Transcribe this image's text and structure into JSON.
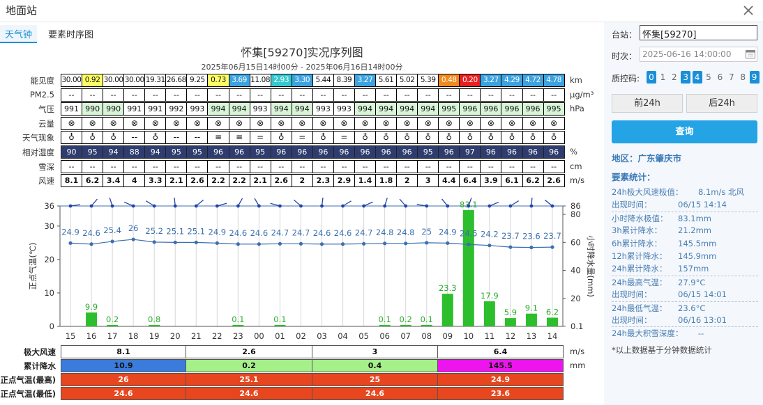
{
  "window": {
    "title": "地面站"
  },
  "tabs": [
    "天气钟",
    "要素时序图"
  ],
  "chart": {
    "title": "怀集[59270]实况序列图",
    "subtitle": "2025年06月15日14时00分 - 2025年06月16日14时00分"
  },
  "rows": [
    {
      "label": "能见度",
      "unit": "km",
      "kind": "vis",
      "values": [
        "30.00",
        "0.92",
        "30.00",
        "30.00",
        "19.31",
        "26.68",
        "9.25",
        "0.73",
        "3.69",
        "11.08",
        "2.93",
        "3.30",
        "5.44",
        "8.39",
        "3.27",
        "5.61",
        "5.02",
        "5.39",
        "0.48",
        "0.20",
        "3.27",
        "4.29",
        "4.72",
        "4.78"
      ]
    },
    {
      "label": "PM2.5",
      "unit": "μg/m³",
      "kind": "plain",
      "values": [
        "--",
        "--",
        "--",
        "--",
        "--",
        "--",
        "--",
        "--",
        "--",
        "--",
        "--",
        "--",
        "--",
        "--",
        "--",
        "--",
        "--",
        "--",
        "--",
        "--",
        "--",
        "--",
        "--",
        "--"
      ]
    },
    {
      "label": "气压",
      "unit": "hPa",
      "kind": "press",
      "values": [
        "991",
        "990",
        "990",
        "991",
        "991",
        "992",
        "993",
        "994",
        "994",
        "993",
        "994",
        "994",
        "993",
        "993",
        "994",
        "994",
        "994",
        "994",
        "995",
        "996",
        "996",
        "996",
        "996",
        "995"
      ]
    },
    {
      "label": "云量",
      "unit": "",
      "kind": "wx",
      "values": [
        "⊗",
        "⊗",
        "⊗",
        "⊗",
        "⊗",
        "⊗",
        "⊗",
        "⊗",
        "⊗",
        "⊗",
        "⊗",
        "⊗",
        "⊗",
        "⊗",
        "⊗",
        "⊗",
        "⊗",
        "⊗",
        "⊗",
        "⊗",
        "⊗",
        "⊗",
        "⊗",
        "⊗"
      ]
    },
    {
      "label": "天气现象",
      "unit": "",
      "kind": "wx",
      "values": [
        "♁",
        "♁",
        "♁",
        "--",
        "♁",
        "--",
        "--",
        "≡",
        "≡",
        "=",
        "♁",
        "=",
        "♁",
        "=",
        "♁",
        "♁",
        "♁",
        "♁",
        "♁",
        "♁",
        "♁",
        "♁",
        "♁",
        "♁"
      ]
    },
    {
      "label": "相对湿度",
      "unit": "%",
      "kind": "hum",
      "values": [
        "90",
        "95",
        "94",
        "88",
        "94",
        "95",
        "95",
        "96",
        "96",
        "95",
        "96",
        "96",
        "96",
        "96",
        "96",
        "96",
        "96",
        "95",
        "96",
        "97",
        "96",
        "96",
        "96",
        "96"
      ]
    },
    {
      "label": "雪深",
      "unit": "cm",
      "kind": "plain",
      "values": [
        "--",
        "--",
        "--",
        "--",
        "--",
        "--",
        "--",
        "--",
        "--",
        "--",
        "--",
        "--",
        "--",
        "--",
        "--",
        "--",
        "--",
        "--",
        "--",
        "--",
        "--",
        "--",
        "--",
        "--"
      ]
    },
    {
      "label": "风速",
      "unit": "m/s",
      "kind": "bold",
      "values": [
        "8.1",
        "6.2",
        "3.4",
        "4",
        "3.3",
        "2.1",
        "2.6",
        "2.2",
        "2.2",
        "2.1",
        "2.6",
        "2",
        "2.3",
        "2.9",
        "1.4",
        "1.8",
        "2",
        "3",
        "4.4",
        "6.4",
        "3.9",
        "6.1",
        "6.2",
        "2.6"
      ]
    }
  ],
  "cell_colors": {
    "vis": [
      "#fff",
      "#ffff66",
      "#fff",
      "#fff",
      "#fff",
      "#fff",
      "#fff",
      "#ffff66",
      "#3da3e0",
      "#fff",
      "#34c9d0",
      "#3da3e0",
      "#fff",
      "#fff",
      "#3da3e0",
      "#fff",
      "#fff",
      "#fff",
      "#f08a1c",
      "#e82020",
      "#3da3e0",
      "#3da3e0",
      "#3da3e0",
      "#3da3e0"
    ],
    "press": [
      "#fff",
      "#d8f5d8",
      "#d8f5d8",
      "#fff",
      "#fff",
      "#fff",
      "#fff",
      "#d8f5d8",
      "#d8f5d8",
      "#fff",
      "#d8f5d8",
      "#d8f5d8",
      "#fff",
      "#fff",
      "#d8f5d8",
      "#d8f5d8",
      "#d8f5d8",
      "#d8f5d8",
      "#d8f5d8",
      "#d8f5d8",
      "#d8f5d8",
      "#d8f5d8",
      "#d8f5d8",
      "#d8f5d8"
    ]
  },
  "chart_data": {
    "type": "bar",
    "x": [
      "15",
      "16",
      "17",
      "18",
      "19",
      "20",
      "21",
      "22",
      "23",
      "00",
      "01",
      "02",
      "03",
      "04",
      "05",
      "06",
      "07",
      "08",
      "09",
      "10",
      "11",
      "12",
      "13",
      "14"
    ],
    "series": [
      {
        "axis": "left",
        "type": "line",
        "values": [
          24.9,
          24.6,
          25.4,
          26,
          25.2,
          25.1,
          25.1,
          24.9,
          24.6,
          24.6,
          24.7,
          24.7,
          24.6,
          24.6,
          24.7,
          24.8,
          24.8,
          25,
          24.9,
          24.5,
          24.2,
          23.7,
          23.6,
          23.7
        ]
      },
      {
        "axis": "right",
        "type": "bar",
        "values": [
          0,
          9.9,
          0.2,
          0,
          0.8,
          0,
          0,
          0,
          0.1,
          0,
          0.1,
          0,
          0,
          0,
          0,
          0.1,
          0.2,
          0.1,
          23.3,
          83.1,
          17.9,
          5.9,
          9.1,
          6.2
        ],
        "color": "#2dbe2d"
      }
    ],
    "ylabel": "正点气温(℃)",
    "ylabel_right": "小时降水量(mm)",
    "ylim": [
      0,
      36
    ],
    "yticks": [
      0,
      10,
      20,
      30,
      36
    ],
    "ylim_right": [
      0.1,
      86
    ],
    "yticks_right": [
      0.1,
      20,
      40,
      60,
      80,
      86
    ]
  },
  "summary": {
    "rows": [
      {
        "label": "极大风速",
        "unit": "m/s",
        "values": [
          "8.1",
          "2.6",
          "3",
          "6.4"
        ],
        "colors": [
          "#fff",
          "#fff",
          "#fff",
          "#fff"
        ]
      },
      {
        "label": "累计降水",
        "unit": "mm",
        "values": [
          "10.9",
          "0.2",
          "0.4",
          "145.5"
        ],
        "colors": [
          "#3a7bdc",
          "#a6f08a",
          "#a6f08a",
          "#ee14ee"
        ]
      },
      {
        "label": "正点气温(最高)",
        "unit": "",
        "values": [
          "26",
          "25.1",
          "25",
          "24.9"
        ],
        "colors": [
          "#e8461e",
          "#e8461e",
          "#e8461e",
          "#e8461e"
        ]
      },
      {
        "label": "正点气温(最低)",
        "unit": "",
        "values": [
          "24.6",
          "24.6",
          "24.6",
          "23.6"
        ],
        "colors": [
          "#e8461e",
          "#e8461e",
          "#e8461e",
          "#e8461e"
        ]
      }
    ]
  },
  "sidebar": {
    "station_label": "台站：",
    "station_value": "怀集[59270]",
    "time_label": "时次：",
    "time_placeholder": "2025-06-16 14:00:00",
    "qc_label": "质控码:",
    "qc_codes": [
      "0",
      "1",
      "2",
      "3",
      "4",
      "5",
      "6",
      "7",
      "8",
      "9"
    ],
    "qc_selected": [
      0,
      3,
      4,
      9
    ],
    "prev_label": "前24h",
    "next_label": "后24h",
    "query_label": "查询",
    "region": "地区：广东肇庆市",
    "stats_title": "要素统计：",
    "stats": [
      {
        "k": "24h极大风速极值：",
        "v": "8.1m/s 北风"
      },
      {
        "k": "出现时间：",
        "v": "06/15 14:14"
      },
      {
        "k": "小时降水极值：",
        "v": "83.1mm"
      },
      {
        "k": "3h累计降水：",
        "v": "21.2mm"
      },
      {
        "k": "6h累计降水：",
        "v": "145.5mm"
      },
      {
        "k": "12h累计降水：",
        "v": "145.9mm"
      },
      {
        "k": "24h累计降水：",
        "v": "157mm"
      },
      {
        "k": "24h最高气温：",
        "v": "27.9°C"
      },
      {
        "k": "出现时间：",
        "v": "06/15 14:01"
      },
      {
        "k": "24h最低气温：",
        "v": "23.6°C"
      },
      {
        "k": "出现时间：",
        "v": "06/16 13:01"
      },
      {
        "k": "24h最大积雪深度：",
        "v": "--"
      }
    ],
    "footnote": "*以上数据基于分钟数据统计"
  }
}
